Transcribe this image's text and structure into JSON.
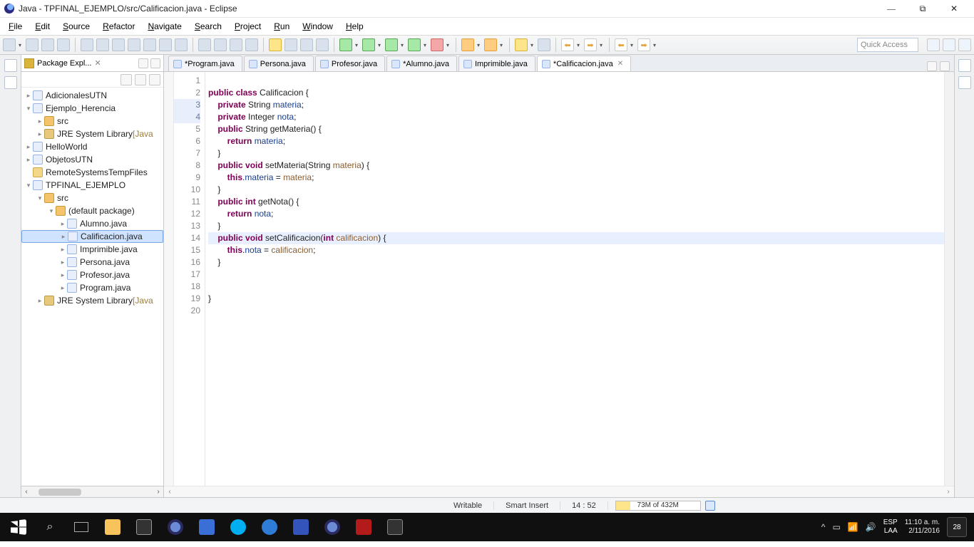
{
  "window": {
    "title": "Java - TPFINAL_EJEMPLO/src/Calificacion.java - Eclipse"
  },
  "menu": [
    "File",
    "Edit",
    "Source",
    "Refactor",
    "Navigate",
    "Search",
    "Project",
    "Run",
    "Window",
    "Help"
  ],
  "quick_access_placeholder": "Quick Access",
  "explorer": {
    "title": "Package Expl...",
    "tree": [
      {
        "d": 0,
        "caret": ">",
        "icon": "java",
        "label": "AdicionalesUTN"
      },
      {
        "d": 0,
        "caret": "v",
        "icon": "java",
        "label": "Ejemplo_Herencia"
      },
      {
        "d": 1,
        "caret": ">",
        "icon": "pkg",
        "label": "src"
      },
      {
        "d": 1,
        "caret": ">",
        "icon": "lib",
        "label": "JRE System Library ",
        "suffix": "[Java"
      },
      {
        "d": 0,
        "caret": ">",
        "icon": "java",
        "label": "HelloWorld"
      },
      {
        "d": 0,
        "caret": ">",
        "icon": "java",
        "label": "ObjetosUTN"
      },
      {
        "d": 0,
        "caret": "",
        "icon": "fld",
        "label": "RemoteSystemsTempFiles"
      },
      {
        "d": 0,
        "caret": "v",
        "icon": "java",
        "label": "TPFINAL_EJEMPLO"
      },
      {
        "d": 1,
        "caret": "v",
        "icon": "pkg",
        "label": "src"
      },
      {
        "d": 2,
        "caret": "v",
        "icon": "pkg",
        "label": "(default package)"
      },
      {
        "d": 3,
        "caret": ">",
        "icon": "java",
        "label": "Alumno.java"
      },
      {
        "d": 3,
        "caret": ">",
        "icon": "java",
        "label": "Calificacion.java",
        "sel": true
      },
      {
        "d": 3,
        "caret": ">",
        "icon": "java",
        "label": "Imprimible.java"
      },
      {
        "d": 3,
        "caret": ">",
        "icon": "java",
        "label": "Persona.java"
      },
      {
        "d": 3,
        "caret": ">",
        "icon": "java",
        "label": "Profesor.java"
      },
      {
        "d": 3,
        "caret": ">",
        "icon": "java",
        "label": "Program.java"
      },
      {
        "d": 1,
        "caret": ">",
        "icon": "lib",
        "label": "JRE System Library ",
        "suffix": "[Java"
      }
    ]
  },
  "tabs": [
    {
      "label": "*Program.java",
      "active": false,
      "dirty": true
    },
    {
      "label": "Persona.java",
      "active": false
    },
    {
      "label": "Profesor.java",
      "active": false
    },
    {
      "label": "*Alumno.java",
      "active": false,
      "dirty": true
    },
    {
      "label": "Imprimible.java",
      "active": false
    },
    {
      "label": "*Calificacion.java",
      "active": true,
      "dirty": true,
      "closeable": true
    }
  ],
  "code": {
    "lines": [
      {
        "n": 1,
        "t": ""
      },
      {
        "n": 2,
        "t": "<kw>public</kw> <kw>class</kw> Calificacion {"
      },
      {
        "n": 3,
        "hl": true,
        "t": "    <kw>private</kw> String <fld>materia</fld>;"
      },
      {
        "n": 4,
        "hl": true,
        "t": "    <kw>private</kw> Integer <fld>nota</fld>;"
      },
      {
        "n": 5,
        "t": "    <kw>public</kw> String getMateria() {"
      },
      {
        "n": 6,
        "t": "        <kw>return</kw> <fld>materia</fld>;"
      },
      {
        "n": 7,
        "t": "    }"
      },
      {
        "n": 8,
        "t": "    <kw>public</kw> <kw>void</kw> setMateria(String <sf>materia</sf>) {"
      },
      {
        "n": 9,
        "t": "        <kw>this</kw>.<fld>materia</fld> = <sf>materia</sf>;"
      },
      {
        "n": 10,
        "t": "    }"
      },
      {
        "n": 11,
        "t": "    <kw>public</kw> <kw>int</kw> getNota() {"
      },
      {
        "n": 12,
        "t": "        <kw>return</kw> <fld>nota</fld>;"
      },
      {
        "n": 13,
        "t": "    }"
      },
      {
        "n": 14,
        "cursor": true,
        "t": "    <kw>public</kw> <kw>void</kw> setCalificacion(<kw>int</kw> <sf>calificacion</sf>) {"
      },
      {
        "n": 15,
        "t": "        <kw>this</kw>.<fld>nota</fld> = <sf>calificacion</sf>;"
      },
      {
        "n": 16,
        "t": "    }"
      },
      {
        "n": 17,
        "t": ""
      },
      {
        "n": 18,
        "t": ""
      },
      {
        "n": 19,
        "t": "}"
      },
      {
        "n": 20,
        "t": ""
      }
    ]
  },
  "status": {
    "writable": "Writable",
    "insert": "Smart Insert",
    "pos": "14 : 52",
    "mem": "73M of 432M"
  },
  "tray": {
    "lang1": "ESP",
    "lang2": "LAA",
    "time": "11:10 a. m.",
    "date": "2/11/2016",
    "notif": "28"
  }
}
